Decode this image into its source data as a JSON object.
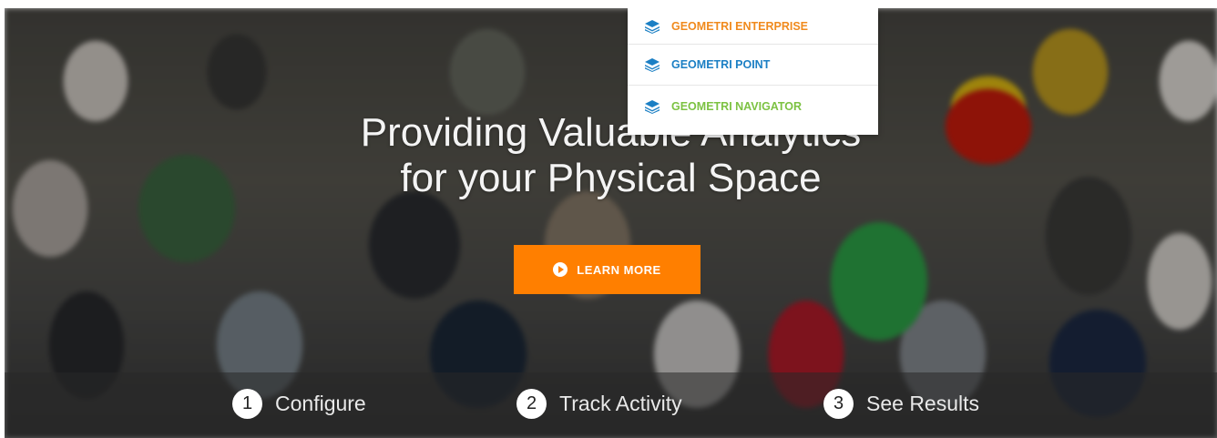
{
  "hero": {
    "headline_line1": "Providing Valuable Analytics",
    "headline_line2": "for your Physical Space",
    "cta_label": "LEARN MORE",
    "cta_color": "#ff7f00"
  },
  "steps": [
    {
      "number": "1",
      "label": "Configure"
    },
    {
      "number": "2",
      "label": "Track Activity"
    },
    {
      "number": "3",
      "label": "See Results"
    }
  ],
  "products_menu": {
    "items": [
      {
        "label": "GEOMETRI ENTERPRISE",
        "color": "#f08a1d",
        "icon": "layers-icon"
      },
      {
        "label": "GEOMETRI POINT",
        "color": "#1b7fc4",
        "icon": "layers-icon"
      },
      {
        "label": "GEOMETRI NAVIGATOR",
        "color": "#7cc242",
        "icon": "layers-icon"
      }
    ],
    "icon_color": "#1b7fc4"
  }
}
